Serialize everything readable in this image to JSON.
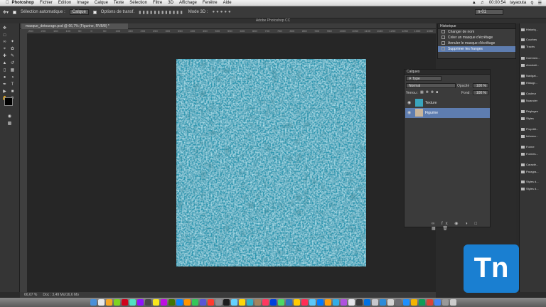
{
  "menubar": {
    "app": "Photoshop",
    "items": [
      "Fichier",
      "Edition",
      "Image",
      "Calque",
      "Texte",
      "Sélection",
      "Filtre",
      "3D",
      "Affichage",
      "Fenêtre",
      "Aide"
    ],
    "clock": "00:00:54",
    "user": "tayaouta"
  },
  "options_bar": {
    "auto_select_label": "Sélection automatique :",
    "auto_select_value": "Calque",
    "transform_label": "Options de transf.",
    "mode3d_label": "Mode 3D :",
    "workspace_value": "n-01"
  },
  "app_title": "Adobe Photoshop CC",
  "document_tab": "masque_detourage.psd @ 66,7% (Figurine, RVB/8) *",
  "ruler_ticks": [
    "250",
    "200",
    "150",
    "100",
    "50",
    "0",
    "50",
    "100",
    "150",
    "200",
    "250",
    "300",
    "350",
    "400",
    "450",
    "500",
    "550",
    "600",
    "650",
    "700",
    "750",
    "800",
    "850",
    "900",
    "950",
    "1000",
    "1050",
    "1100",
    "1150",
    "1200",
    "1250",
    "1300",
    "1350"
  ],
  "status": {
    "zoom": "66,67 %",
    "doc": "Doc : 3,49 Mo/16,6 Mo"
  },
  "history": {
    "title": "Historique",
    "items": [
      {
        "label": "Changer de nom",
        "active": false
      },
      {
        "label": "Créer un masque d'écrêtage",
        "active": false
      },
      {
        "label": "Annuler le masque d'écrêtage",
        "active": false
      },
      {
        "label": "Supprimer les franges",
        "active": true
      }
    ]
  },
  "layers": {
    "title": "Calques",
    "filter": "Type",
    "blend_mode": "Normal",
    "opacity_label": "Opacité :",
    "opacity_value": "100 %",
    "lock_label": "Verrou :",
    "fill_label": "Fond :",
    "fill_value": "100 %",
    "items": [
      {
        "name": "Texture",
        "selected": false,
        "thumb_color": "#3aa5bd"
      },
      {
        "name": "Figurine",
        "selected": true,
        "thumb_color": "#c9b59a"
      }
    ]
  },
  "right_panels": [
    {
      "label": "Historiq..."
    },
    {
      "label": "Courbes"
    },
    {
      "label": "Tracés"
    },
    {
      "label": "Commen..."
    },
    {
      "label": "Annotati..."
    },
    {
      "label": "Navigat..."
    },
    {
      "label": "Histogr..."
    },
    {
      "label": "Couleur"
    },
    {
      "label": "Nuancier"
    },
    {
      "label": "Réglages"
    },
    {
      "label": "Styles"
    },
    {
      "label": "Propriét..."
    },
    {
      "label": "Informa..."
    },
    {
      "label": "Forme"
    },
    {
      "label": "Formes..."
    },
    {
      "label": "Caractè..."
    },
    {
      "label": "Paragra..."
    },
    {
      "label": "Styles d..."
    },
    {
      "label": "Styles d..."
    }
  ],
  "logo_text": "Tn",
  "colors": {
    "accent": "#5e7db0",
    "canvas": "#3aa5bd",
    "logo": "#1a7fd1"
  }
}
